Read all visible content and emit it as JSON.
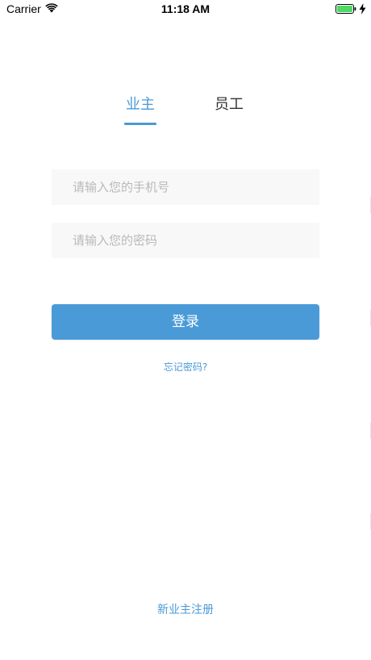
{
  "status_bar": {
    "carrier": "Carrier",
    "time": "11:18 AM",
    "icons": [
      "wifi-icon",
      "battery-icon",
      "charging-bolt-icon"
    ],
    "battery_color": "#4cd964"
  },
  "tabs": [
    {
      "label": "业主",
      "active": true
    },
    {
      "label": "员工",
      "active": false
    }
  ],
  "form": {
    "phone_placeholder": "请输入您的手机号",
    "password_placeholder": "请输入您的密码",
    "login_label": "登录",
    "forgot_label": "忘记密码?"
  },
  "footer": {
    "register_label": "新业主注册"
  },
  "colors": {
    "accent": "#4a9ad8",
    "input_bg": "#f8f8f8",
    "inactive_tab": "#333333"
  }
}
